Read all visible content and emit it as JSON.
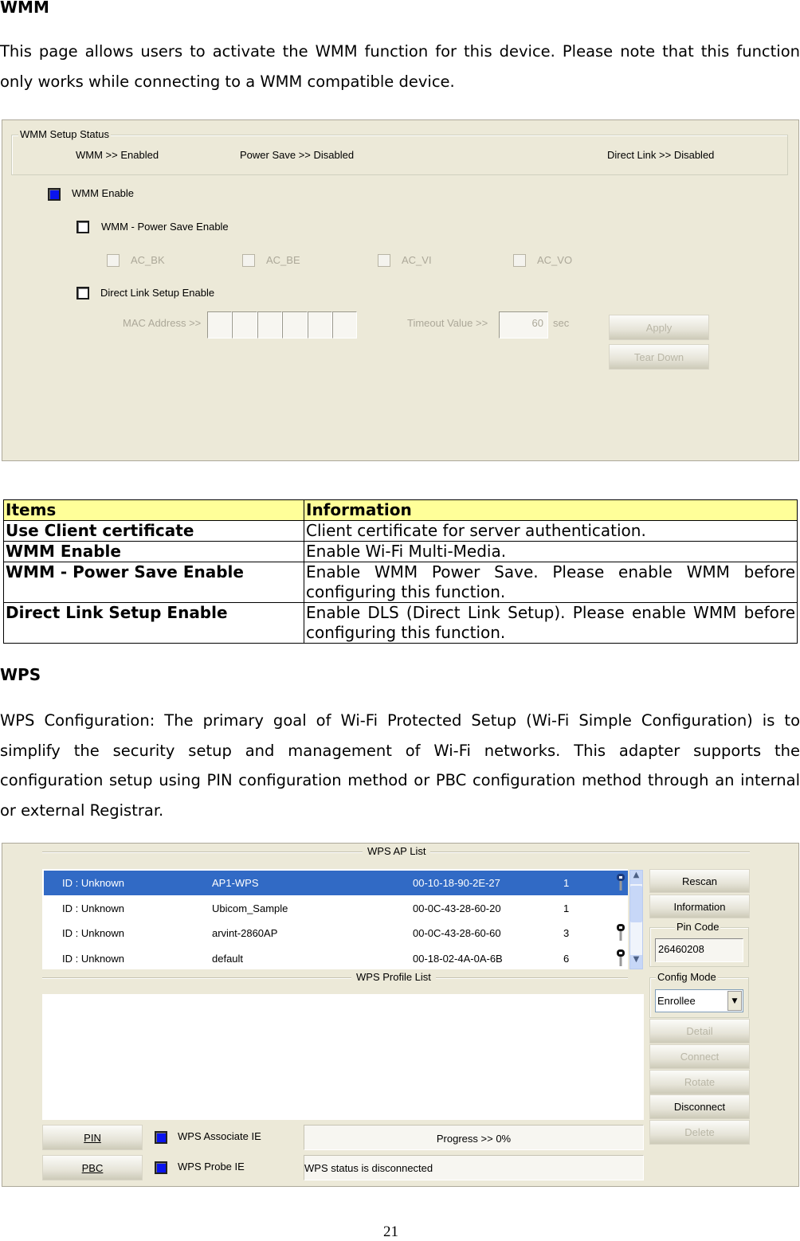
{
  "wmm": {
    "heading": "WMM",
    "intro": "This page allows users to activate the WMM function for this device. Please note that this function only works while connecting to a WMM compatible device.",
    "status_legend": "WMM Setup Status",
    "status_wmm": "WMM >> Enabled",
    "status_ps": "Power Save >> Disabled",
    "status_dl": "Direct Link >> Disabled",
    "enable_label": "WMM Enable",
    "enable_checked": true,
    "ps_label": "WMM - Power Save Enable",
    "ps_checked": false,
    "ac": [
      "AC_BK",
      "AC_BE",
      "AC_VI",
      "AC_VO"
    ],
    "dl_label": "Direct Link Setup Enable",
    "dl_checked": false,
    "mac_label": "MAC Address >>",
    "timeout_label": "Timeout Value >>",
    "timeout_value": "60",
    "timeout_unit": "sec",
    "apply": "Apply",
    "teardown": "Tear Down"
  },
  "table": {
    "headers": [
      "Items",
      "Information"
    ],
    "rows": [
      [
        "Use Client certificate",
        "Client certificate for server authentication."
      ],
      [
        "WMM Enable",
        "Enable Wi-Fi Multi-Media."
      ],
      [
        "WMM - Power Save Enable",
        "Enable WMM Power Save. Please enable WMM before configuring this function."
      ],
      [
        "Direct Link Setup Enable",
        "Enable DLS (Direct Link Setup). Please enable WMM before configuring this function."
      ]
    ]
  },
  "wps": {
    "heading": "WPS",
    "intro": "WPS Configuration: The primary goal of Wi-Fi Protected Setup (Wi-Fi Simple Configuration) is to simplify the security setup and management of Wi-Fi networks. This adapter supports the configuration setup using PIN configuration method or PBC configuration method through an internal or external Registrar.",
    "ap_list_title": "WPS AP List",
    "profile_list_title": "WPS Profile List",
    "ap_list": [
      {
        "id": "ID : Unknown",
        "ssid": "AP1-WPS",
        "mac": "00-10-18-90-2E-27",
        "channel": "1",
        "locked": true,
        "selected": true
      },
      {
        "id": "ID : Unknown",
        "ssid": "Ubicom_Sample",
        "mac": "00-0C-43-28-60-20",
        "channel": "1",
        "locked": false,
        "selected": false
      },
      {
        "id": "ID : Unknown",
        "ssid": "arvint-2860AP",
        "mac": "00-0C-43-28-60-60",
        "channel": "3",
        "locked": true,
        "selected": false
      },
      {
        "id": "ID : Unknown",
        "ssid": "default",
        "mac": "00-18-02-4A-0A-6B",
        "channel": "6",
        "locked": true,
        "selected": false
      }
    ],
    "rescan": "Rescan",
    "information": "Information",
    "pin_code_legend": "Pin Code",
    "pin_code": "26460208",
    "config_mode_legend": "Config Mode",
    "config_mode": "Enrollee",
    "detail": "Detail",
    "connect": "Connect",
    "rotate": "Rotate",
    "disconnect": "Disconnect",
    "delete": "Delete",
    "pin": "PIN",
    "pbc": "PBC",
    "assoc_ie": "WPS Associate IE",
    "assoc_ie_checked": true,
    "probe_ie": "WPS Probe IE",
    "probe_ie_checked": true,
    "progress": "Progress >> 0%",
    "progress_value": 0,
    "status": "WPS status is disconnected"
  },
  "page_number": "21"
}
